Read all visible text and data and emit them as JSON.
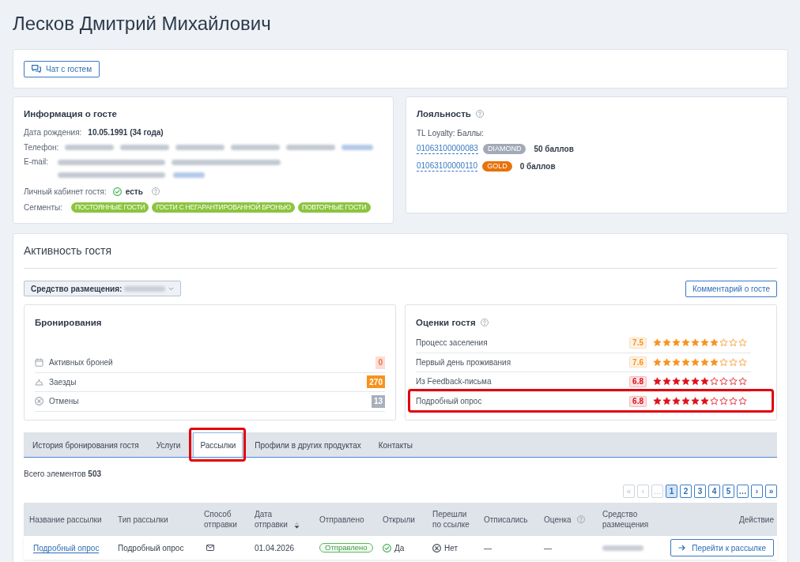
{
  "page": {
    "title": "Лесков Дмитрий Михайлович"
  },
  "toolbar": {
    "chat_button": "Чат с гостем"
  },
  "guest_info": {
    "title": "Информация о госте",
    "fields": [
      {
        "kind": "birthdate",
        "label": "Дата рождения:",
        "value": "10.05.1991 (34 года)"
      },
      {
        "kind": "phones",
        "label": "Телефон:"
      },
      {
        "kind": "emails",
        "label": "E-mail:"
      },
      {
        "kind": "account",
        "label": "Личный кабинет гостя:",
        "value": "есть",
        "checked": true
      },
      {
        "kind": "segments",
        "label": "Сегменты:",
        "tags": [
          "ПОСТОЯННЫЕ ГОСТИ",
          "ГОСТИ С НЕГАРАНТИРОВАННОЙ БРОНЬЮ",
          "ПОВТОРНЫЕ ГОСТИ"
        ]
      }
    ]
  },
  "loyalty": {
    "title": "Лояльность",
    "program": "TL Loyalty: Баллы:",
    "cards": [
      {
        "number": "01063100000083",
        "tier": "DIAMOND",
        "color": "#a2aab7",
        "points": "50 баллов"
      },
      {
        "number": "01063100000110",
        "tier": "GOLD",
        "color": "#e8720c",
        "points": "0 баллов"
      }
    ]
  },
  "activity": {
    "title": "Активность гостя",
    "property_filter": {
      "label": "Средство размещения:"
    },
    "comment_button": "Комментарий о госте",
    "bookings": {
      "title": "Бронирования",
      "items": [
        {
          "kind": "active",
          "label": "Активных броней",
          "count": "0",
          "color": "#fcdcd7"
        },
        {
          "kind": "arrivals",
          "label": "Заезды",
          "count": "270",
          "color": "#f7931e"
        },
        {
          "kind": "cancellations",
          "label": "Отмены",
          "count": "13",
          "color": "#a8b0bc"
        }
      ]
    },
    "ratings": {
      "title": "Оценки гостя",
      "items": [
        {
          "label": "Процесс заселения",
          "score": "7.5",
          "stars": 7,
          "color": "#f7931e",
          "highlighted": false
        },
        {
          "label": "Первый день проживания",
          "score": "7.6",
          "stars": 7,
          "color": "#f7931e",
          "highlighted": false
        },
        {
          "label": "Из Feedback-письма",
          "score": "6.8",
          "stars": 6,
          "color": "#e0101a",
          "highlighted": false
        },
        {
          "label": "Подробный опрос",
          "score": "6.8",
          "stars": 6,
          "color": "#e0101a",
          "highlighted": true
        }
      ]
    }
  },
  "tabs": [
    {
      "label": "История бронирования гостя",
      "selected": false,
      "highlighted": false
    },
    {
      "label": "Услуги",
      "selected": false,
      "highlighted": false
    },
    {
      "label": "Рассылки",
      "selected": true,
      "highlighted": true
    },
    {
      "label": "Профили в других продуктах",
      "selected": false,
      "highlighted": false
    },
    {
      "label": "Контакты",
      "selected": false,
      "highlighted": false
    }
  ],
  "mailings": {
    "total": "Всего элементов **503**",
    "pagination": [
      {
        "label": "«",
        "disabled": true,
        "selected": false
      },
      {
        "label": "‹",
        "disabled": true,
        "selected": false
      },
      {
        "label": "…",
        "disabled": true,
        "selected": false
      },
      {
        "label": "1",
        "disabled": false,
        "selected": true
      },
      {
        "label": "2",
        "disabled": false,
        "selected": false
      },
      {
        "label": "3",
        "disabled": false,
        "selected": false
      },
      {
        "label": "4",
        "disabled": false,
        "selected": false
      },
      {
        "label": "5",
        "disabled": false,
        "selected": false
      },
      {
        "label": "…",
        "disabled": false,
        "selected": false
      },
      {
        "label": "›",
        "disabled": false,
        "selected": false
      },
      {
        "label": "»",
        "disabled": false,
        "selected": false
      }
    ],
    "table": {
      "columns": [
        {
          "label": "Название рассылки"
        },
        {
          "label": "Тип рассылки"
        },
        {
          "label": "Способ отправки"
        },
        {
          "label": "Дата отправки"
        },
        {
          "label": "Отправлено"
        },
        {
          "label": "Открыли"
        },
        {
          "label": "Перешли по ссылке"
        },
        {
          "label": "Отписались"
        },
        {
          "label": "Оценка"
        },
        {
          "label": "Средство размещения"
        },
        {
          "label": "Действие"
        }
      ],
      "rows": [
        {
          "cells": [
            {
              "kind": "link",
              "text": "Подробный опрос"
            },
            {
              "kind": "text",
              "text": "Подробный опрос"
            },
            {
              "kind": "email"
            },
            {
              "kind": "text",
              "text": "01.04.2026"
            },
            {
              "kind": "status",
              "text": "Отправлено"
            },
            {
              "kind": "yes",
              "text": "Да"
            },
            {
              "kind": "no",
              "text": "Нет"
            },
            {
              "kind": "text",
              "text": "—"
            },
            {
              "kind": "text",
              "text": "—"
            },
            {
              "kind": "blurred"
            },
            {
              "kind": "button",
              "text": "Перейти к рассылке"
            }
          ]
        }
      ]
    }
  }
}
